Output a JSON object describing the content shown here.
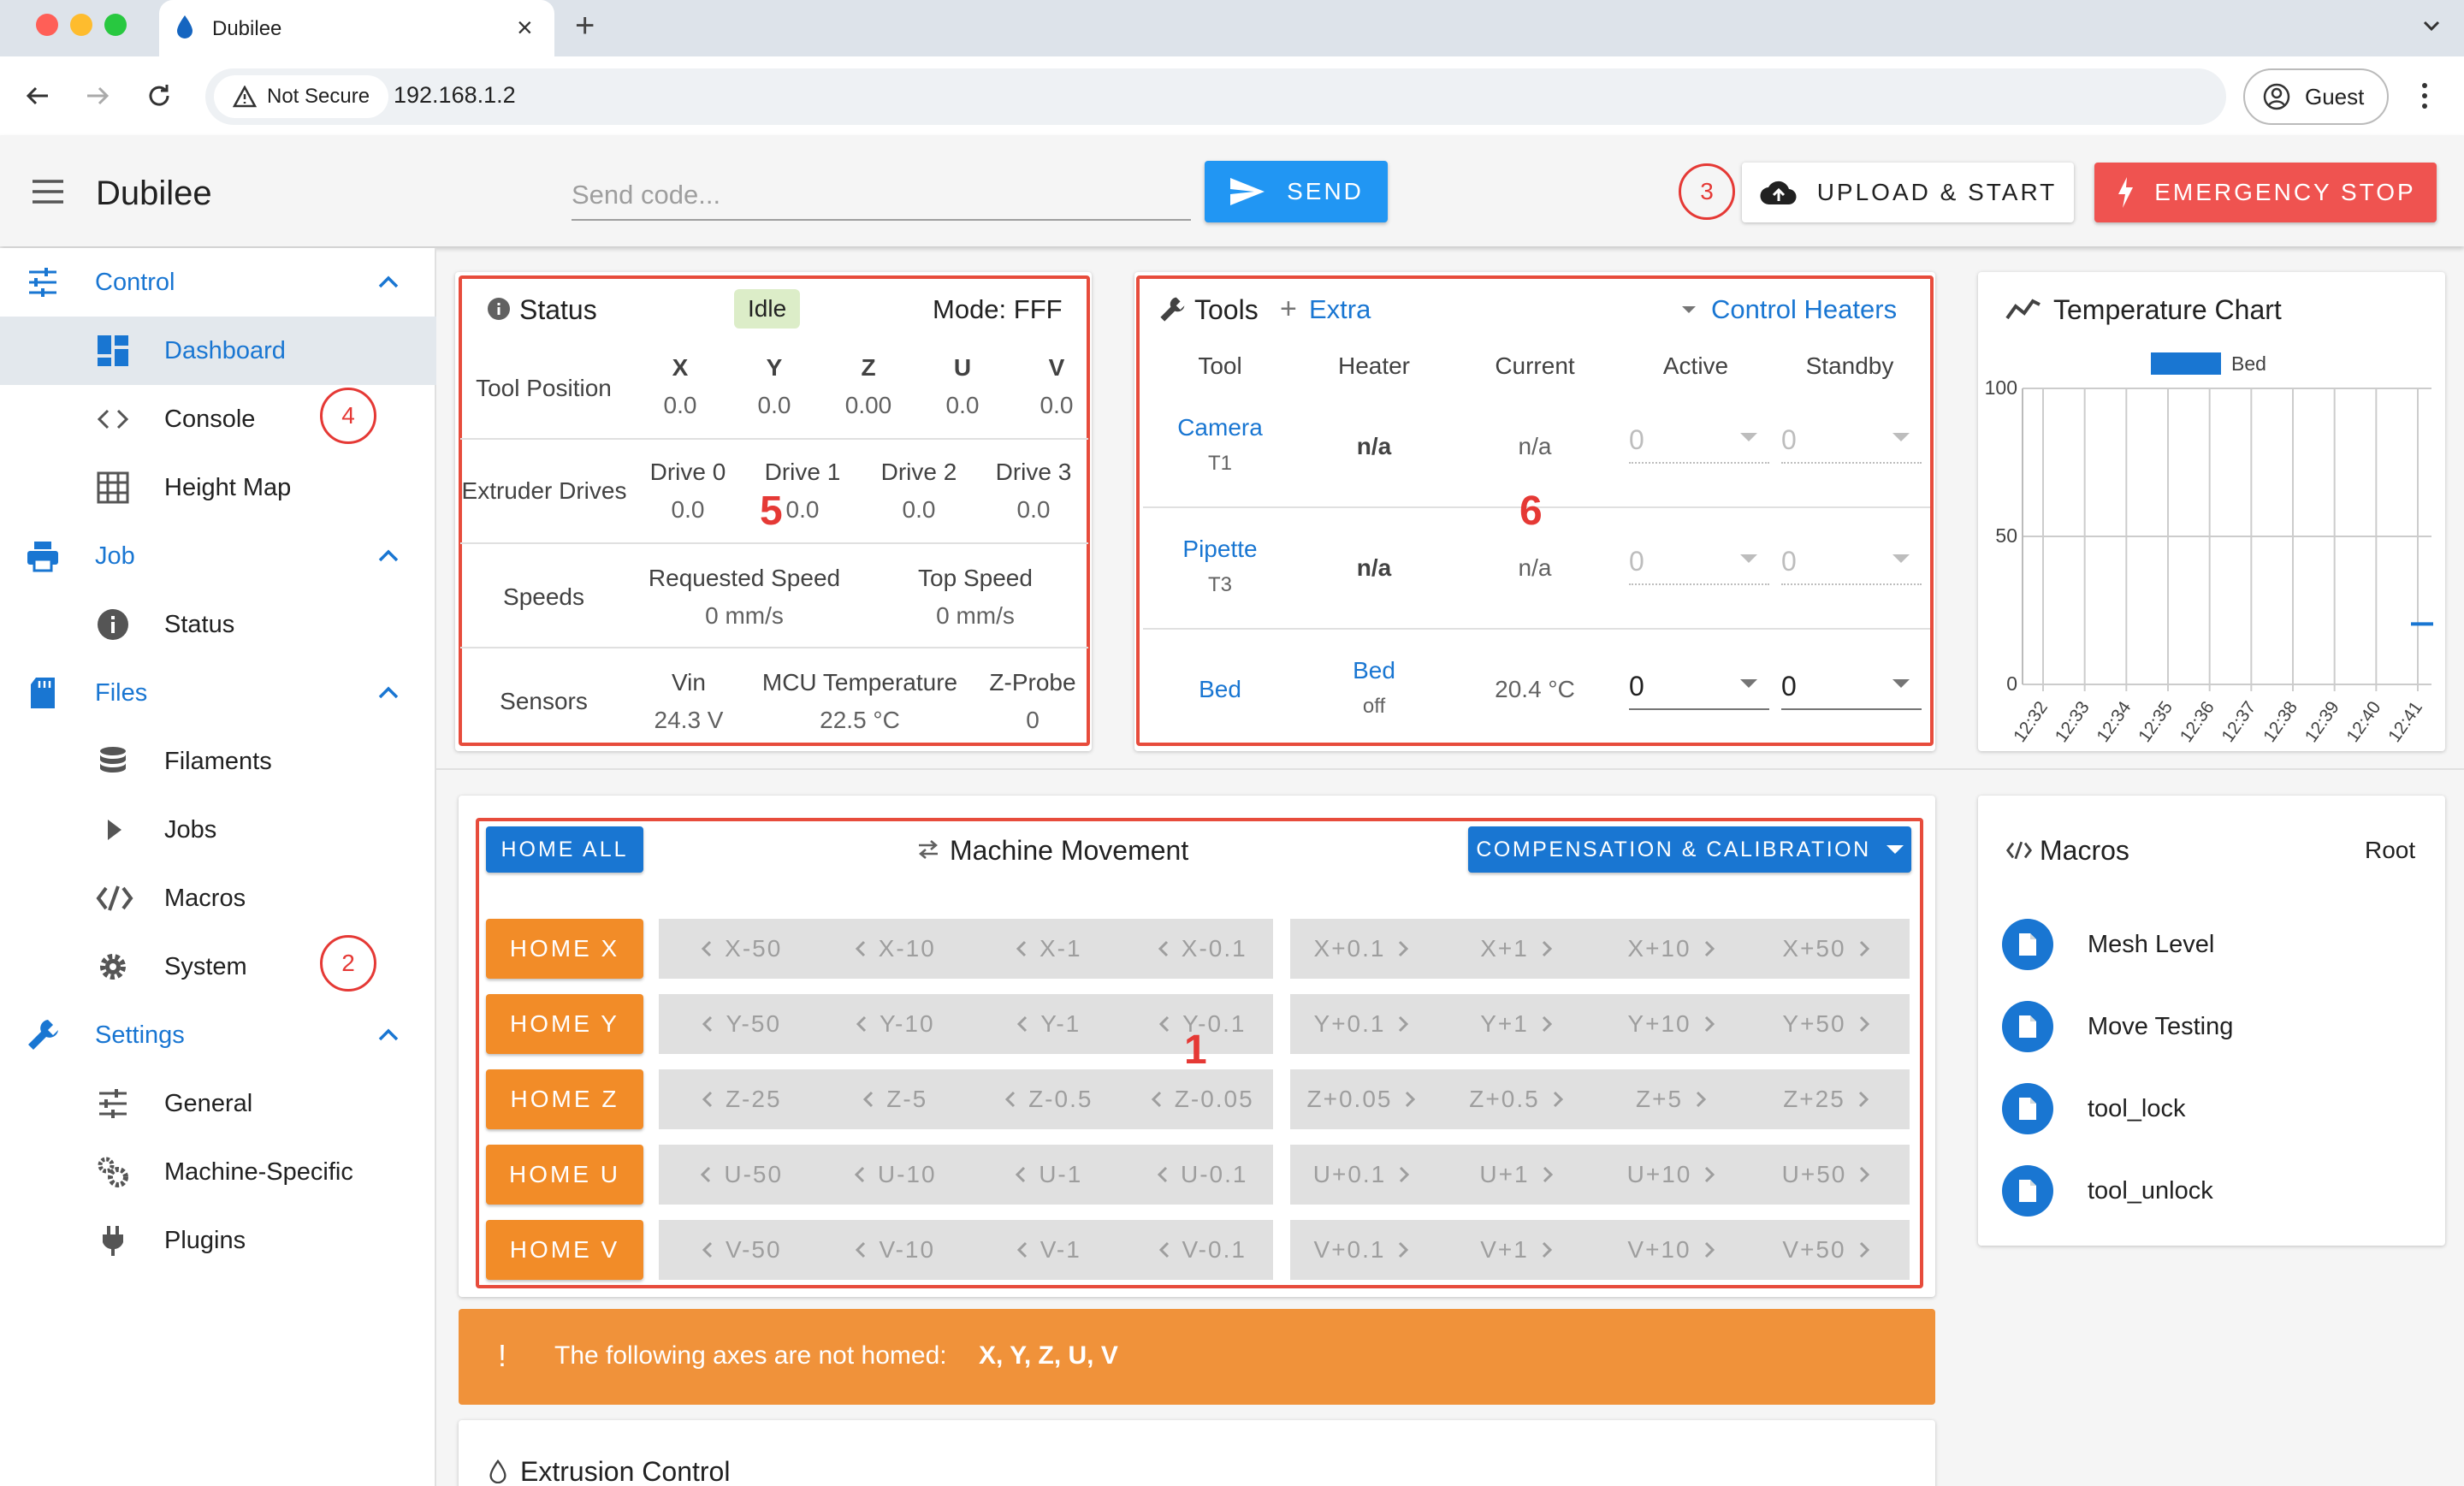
{
  "browser": {
    "tab_title": "Dubilee",
    "security_label": "Not Secure",
    "url": "192.168.1.2",
    "profile": "Guest",
    "new_tab": "+",
    "close": "×"
  },
  "app": {
    "title": "Dubilee",
    "code_placeholder": "Send code...",
    "send_label": "SEND",
    "upload_label": "UPLOAD & START",
    "estop_label": "EMERGENCY STOP"
  },
  "sidebar": {
    "control": {
      "label": "Control",
      "items": [
        "Dashboard",
        "Console",
        "Height Map"
      ]
    },
    "job": {
      "label": "Job",
      "items": [
        "Status"
      ]
    },
    "files": {
      "label": "Files",
      "items": [
        "Filaments",
        "Jobs",
        "Macros",
        "System"
      ]
    },
    "settings": {
      "label": "Settings",
      "items": [
        "General",
        "Machine-Specific",
        "Plugins"
      ]
    }
  },
  "annotations": {
    "n1": "1",
    "n2": "2",
    "n3": "3",
    "n4": "4",
    "n5": "5",
    "n6": "6"
  },
  "status": {
    "title": "Status",
    "state": "Idle",
    "mode": "Mode: FFF",
    "tool_position": {
      "label": "Tool Position",
      "axes": [
        "X",
        "Y",
        "Z",
        "U",
        "V"
      ],
      "values": [
        "0.0",
        "0.0",
        "0.00",
        "0.0",
        "0.0"
      ]
    },
    "extruder": {
      "label": "Extruder Drives",
      "drives": [
        "Drive 0",
        "Drive 1",
        "Drive 2",
        "Drive 3"
      ],
      "values": [
        "0.0",
        "0.0",
        "0.0",
        "0.0"
      ]
    },
    "speeds": {
      "label": "Speeds",
      "requested_label": "Requested Speed",
      "requested": "0 mm/s",
      "top_label": "Top Speed",
      "top": "0 mm/s"
    },
    "sensors": {
      "label": "Sensors",
      "vin_label": "Vin",
      "vin": "24.3 V",
      "mcu_label": "MCU Temperature",
      "mcu": "22.5 °C",
      "zprobe_label": "Z-Probe",
      "zprobe": "0"
    }
  },
  "tools": {
    "title": "Tools",
    "extra": "Extra",
    "control_heaters": "Control Heaters",
    "headers": [
      "Tool",
      "Heater",
      "Current",
      "Active",
      "Standby"
    ],
    "rows": [
      {
        "tool": "Camera",
        "sub": "T1",
        "heater": "n/a",
        "heater_sub": "",
        "current": "n/a",
        "active": "0",
        "standby": "0"
      },
      {
        "tool": "Pipette",
        "sub": "T3",
        "heater": "n/a",
        "heater_sub": "",
        "current": "n/a",
        "active": "0",
        "standby": "0"
      },
      {
        "tool": "Bed",
        "sub": "",
        "heater": "Bed",
        "heater_sub": "off",
        "current": "20.4 °C",
        "active": "0",
        "standby": "0"
      }
    ]
  },
  "chart_data": {
    "type": "line",
    "title": "Temperature Chart",
    "series": [
      {
        "name": "Bed",
        "color": "#1976d2",
        "x": [
          "12:41"
        ],
        "values": [
          20.4
        ]
      }
    ],
    "x": [
      "12:32",
      "12:33",
      "12:34",
      "12:35",
      "12:36",
      "12:37",
      "12:38",
      "12:39",
      "12:40",
      "12:41"
    ],
    "yticks": [
      "100",
      "50",
      "0"
    ],
    "ylim": [
      0,
      100
    ],
    "grid": true,
    "legend": "top"
  },
  "movement": {
    "title": "Machine Movement",
    "home_all": "HOME ALL",
    "compensation": "COMPENSATION & CALIBRATION",
    "rows": [
      {
        "home": "HOME X",
        "neg": [
          "X-50",
          "X-10",
          "X-1",
          "X-0.1"
        ],
        "pos": [
          "X+0.1",
          "X+1",
          "X+10",
          "X+50"
        ]
      },
      {
        "home": "HOME Y",
        "neg": [
          "Y-50",
          "Y-10",
          "Y-1",
          "Y-0.1"
        ],
        "pos": [
          "Y+0.1",
          "Y+1",
          "Y+10",
          "Y+50"
        ]
      },
      {
        "home": "HOME Z",
        "neg": [
          "Z-25",
          "Z-5",
          "Z-0.5",
          "Z-0.05"
        ],
        "pos": [
          "Z+0.05",
          "Z+0.5",
          "Z+5",
          "Z+25"
        ]
      },
      {
        "home": "HOME U",
        "neg": [
          "U-50",
          "U-10",
          "U-1",
          "U-0.1"
        ],
        "pos": [
          "U+0.1",
          "U+1",
          "U+10",
          "U+50"
        ]
      },
      {
        "home": "HOME V",
        "neg": [
          "V-50",
          "V-10",
          "V-1",
          "V-0.1"
        ],
        "pos": [
          "V+0.1",
          "V+1",
          "V+10",
          "V+50"
        ]
      }
    ]
  },
  "macros": {
    "title": "Macros",
    "root": "Root",
    "items": [
      "Mesh Level",
      "Move Testing",
      "tool_lock",
      "tool_unlock"
    ]
  },
  "alert": {
    "icon": "!",
    "text": "The following axes are not homed:",
    "axes": "X, Y, Z, U, V"
  },
  "extrusion": {
    "title": "Extrusion Control"
  },
  "colors": {
    "accent": "#1976d2",
    "danger": "#ef5350",
    "warning": "#f28c28",
    "annotation": "#e53935",
    "idle_bg": "#dcedc8"
  }
}
